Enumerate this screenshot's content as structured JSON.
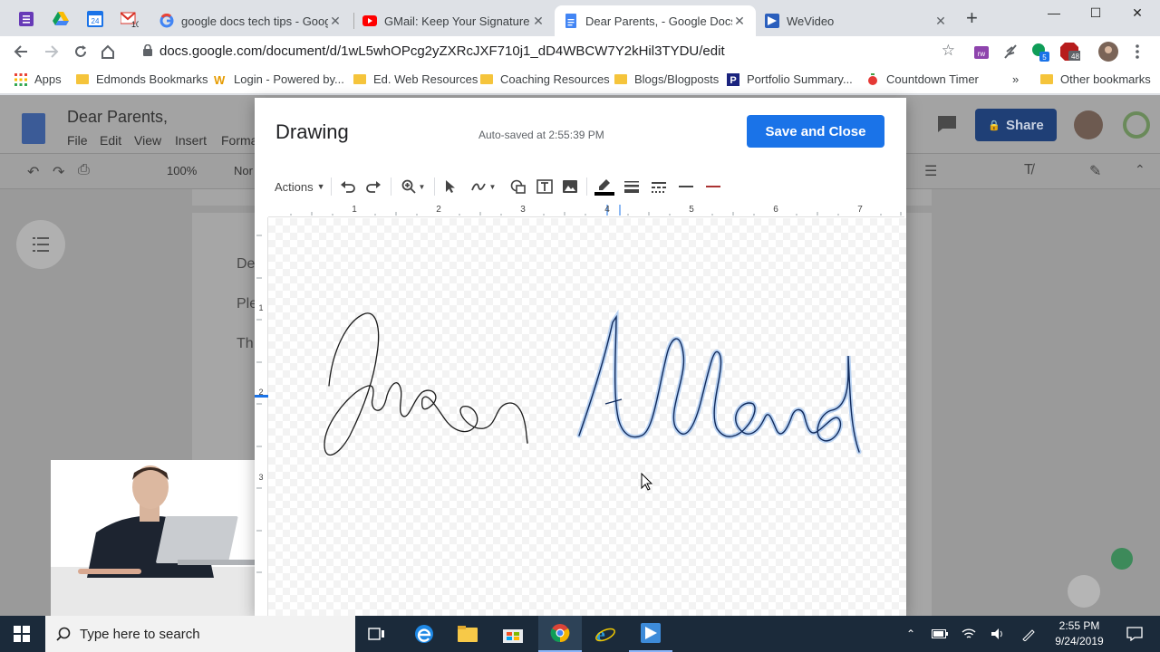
{
  "browser": {
    "pinned_badges": [
      "24",
      "10"
    ],
    "tabs": [
      {
        "label": "google docs tech tips - Google",
        "active": false
      },
      {
        "label": "GMail: Keep Your Signature N",
        "active": false
      },
      {
        "label": "Dear Parents, - Google Docs",
        "active": true
      },
      {
        "label": "WeVideo",
        "active": false
      }
    ],
    "url": "docs.google.com/document/d/1wL5whOPcg2yZXRcJXF710j1_dD4WBCW7Y2kHil3TYDU/edit",
    "ext_badges": [
      "5",
      "48"
    ],
    "bookmarks": [
      {
        "label": "Apps"
      },
      {
        "label": "Edmonds Bookmarks"
      },
      {
        "label": "Login - Powered by..."
      },
      {
        "label": "Ed. Web Resources"
      },
      {
        "label": "Coaching Resources"
      },
      {
        "label": "Blogs/Blogposts"
      },
      {
        "label": "Portfolio Summary..."
      },
      {
        "label": "Countdown Timer"
      },
      {
        "label": "Other bookmarks"
      }
    ]
  },
  "docs": {
    "title": "Dear Parents,",
    "menu": [
      "File",
      "Edit",
      "View",
      "Insert",
      "Forma"
    ],
    "zoom": "100%",
    "style_label": "Nor",
    "share_label": "Share",
    "page_lines": [
      "De",
      "Ple",
      "Th"
    ]
  },
  "drawing": {
    "title": "Drawing",
    "autosave": "Auto-saved at 2:55:39 PM",
    "save_label": "Save and Close",
    "actions_label": "Actions",
    "ruler_h": [
      "1",
      "2",
      "3",
      "4",
      "5",
      "6",
      "7"
    ],
    "ruler_v": [
      "1",
      "2",
      "3"
    ],
    "signature_color": "#102a5c"
  },
  "taskbar": {
    "search_placeholder": "Type here to search",
    "time": "2:55 PM",
    "date": "9/24/2019"
  }
}
